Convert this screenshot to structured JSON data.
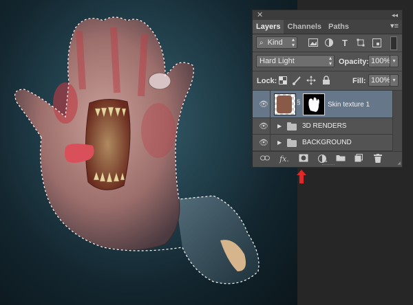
{
  "panel": {
    "tabs": [
      {
        "label": "Layers",
        "active": true
      },
      {
        "label": "Channels",
        "active": false
      },
      {
        "label": "Paths",
        "active": false
      }
    ],
    "filter": {
      "label": "Kind"
    },
    "blend_mode": {
      "value": "Hard Light"
    },
    "opacity": {
      "label": "Opacity:",
      "value": "100%"
    },
    "lock": {
      "label": "Lock:"
    },
    "fill": {
      "label": "Fill:",
      "value": "100%"
    },
    "layers": [
      {
        "name": "Skin texture 1",
        "type": "layer-with-mask",
        "selected": true
      },
      {
        "name": "3D RENDERS",
        "type": "group",
        "selected": false
      },
      {
        "name": "BACKGROUND",
        "type": "group",
        "selected": false
      }
    ],
    "bottom_icons": [
      "link-icon",
      "fx-icon",
      "add-mask-icon",
      "adjustment-icon",
      "new-group-icon",
      "new-layer-icon",
      "trash-icon"
    ],
    "bottom_fx": "fx.",
    "highlight_color": "#e02828"
  }
}
